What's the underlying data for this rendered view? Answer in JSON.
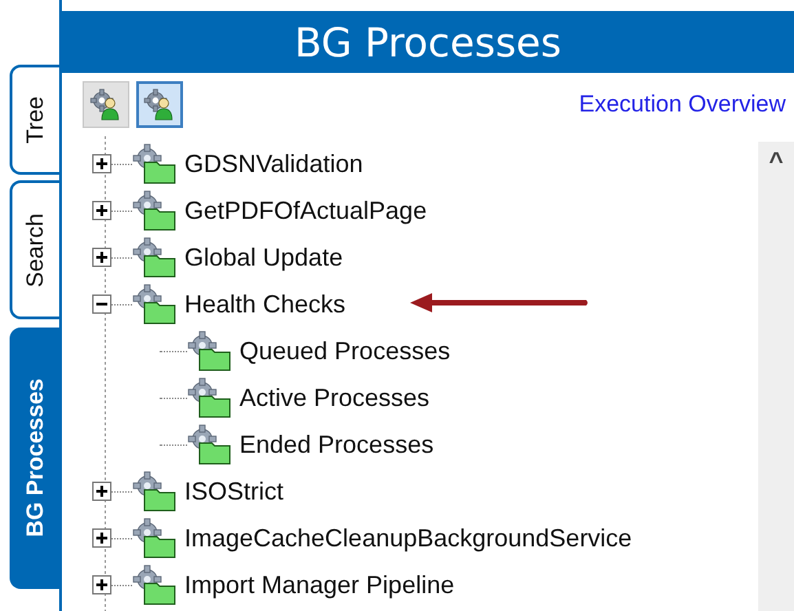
{
  "side_tabs": [
    {
      "label": "Tree",
      "selected": false
    },
    {
      "label": "Search",
      "selected": false
    },
    {
      "label": "BG Processes",
      "selected": true
    }
  ],
  "panel": {
    "title": "BG Processes"
  },
  "toolbar": {
    "buttons": [
      {
        "selected": false
      },
      {
        "selected": true
      }
    ],
    "link": "Execution Overview"
  },
  "tree": [
    {
      "label": "GDSNValidation",
      "expanded": false
    },
    {
      "label": "GetPDFOfActualPage",
      "expanded": false
    },
    {
      "label": "Global Update",
      "expanded": false
    },
    {
      "label": "Health Checks",
      "expanded": true,
      "children": [
        {
          "label": "Queued Processes"
        },
        {
          "label": "Active Processes"
        },
        {
          "label": "Ended Processes"
        }
      ]
    },
    {
      "label": "ISOStrict",
      "expanded": false
    },
    {
      "label": "ImageCacheCleanupBackgroundService",
      "expanded": false
    },
    {
      "label": "Import Manager Pipeline",
      "expanded": false
    }
  ],
  "scrollbar": {
    "up": "^"
  }
}
